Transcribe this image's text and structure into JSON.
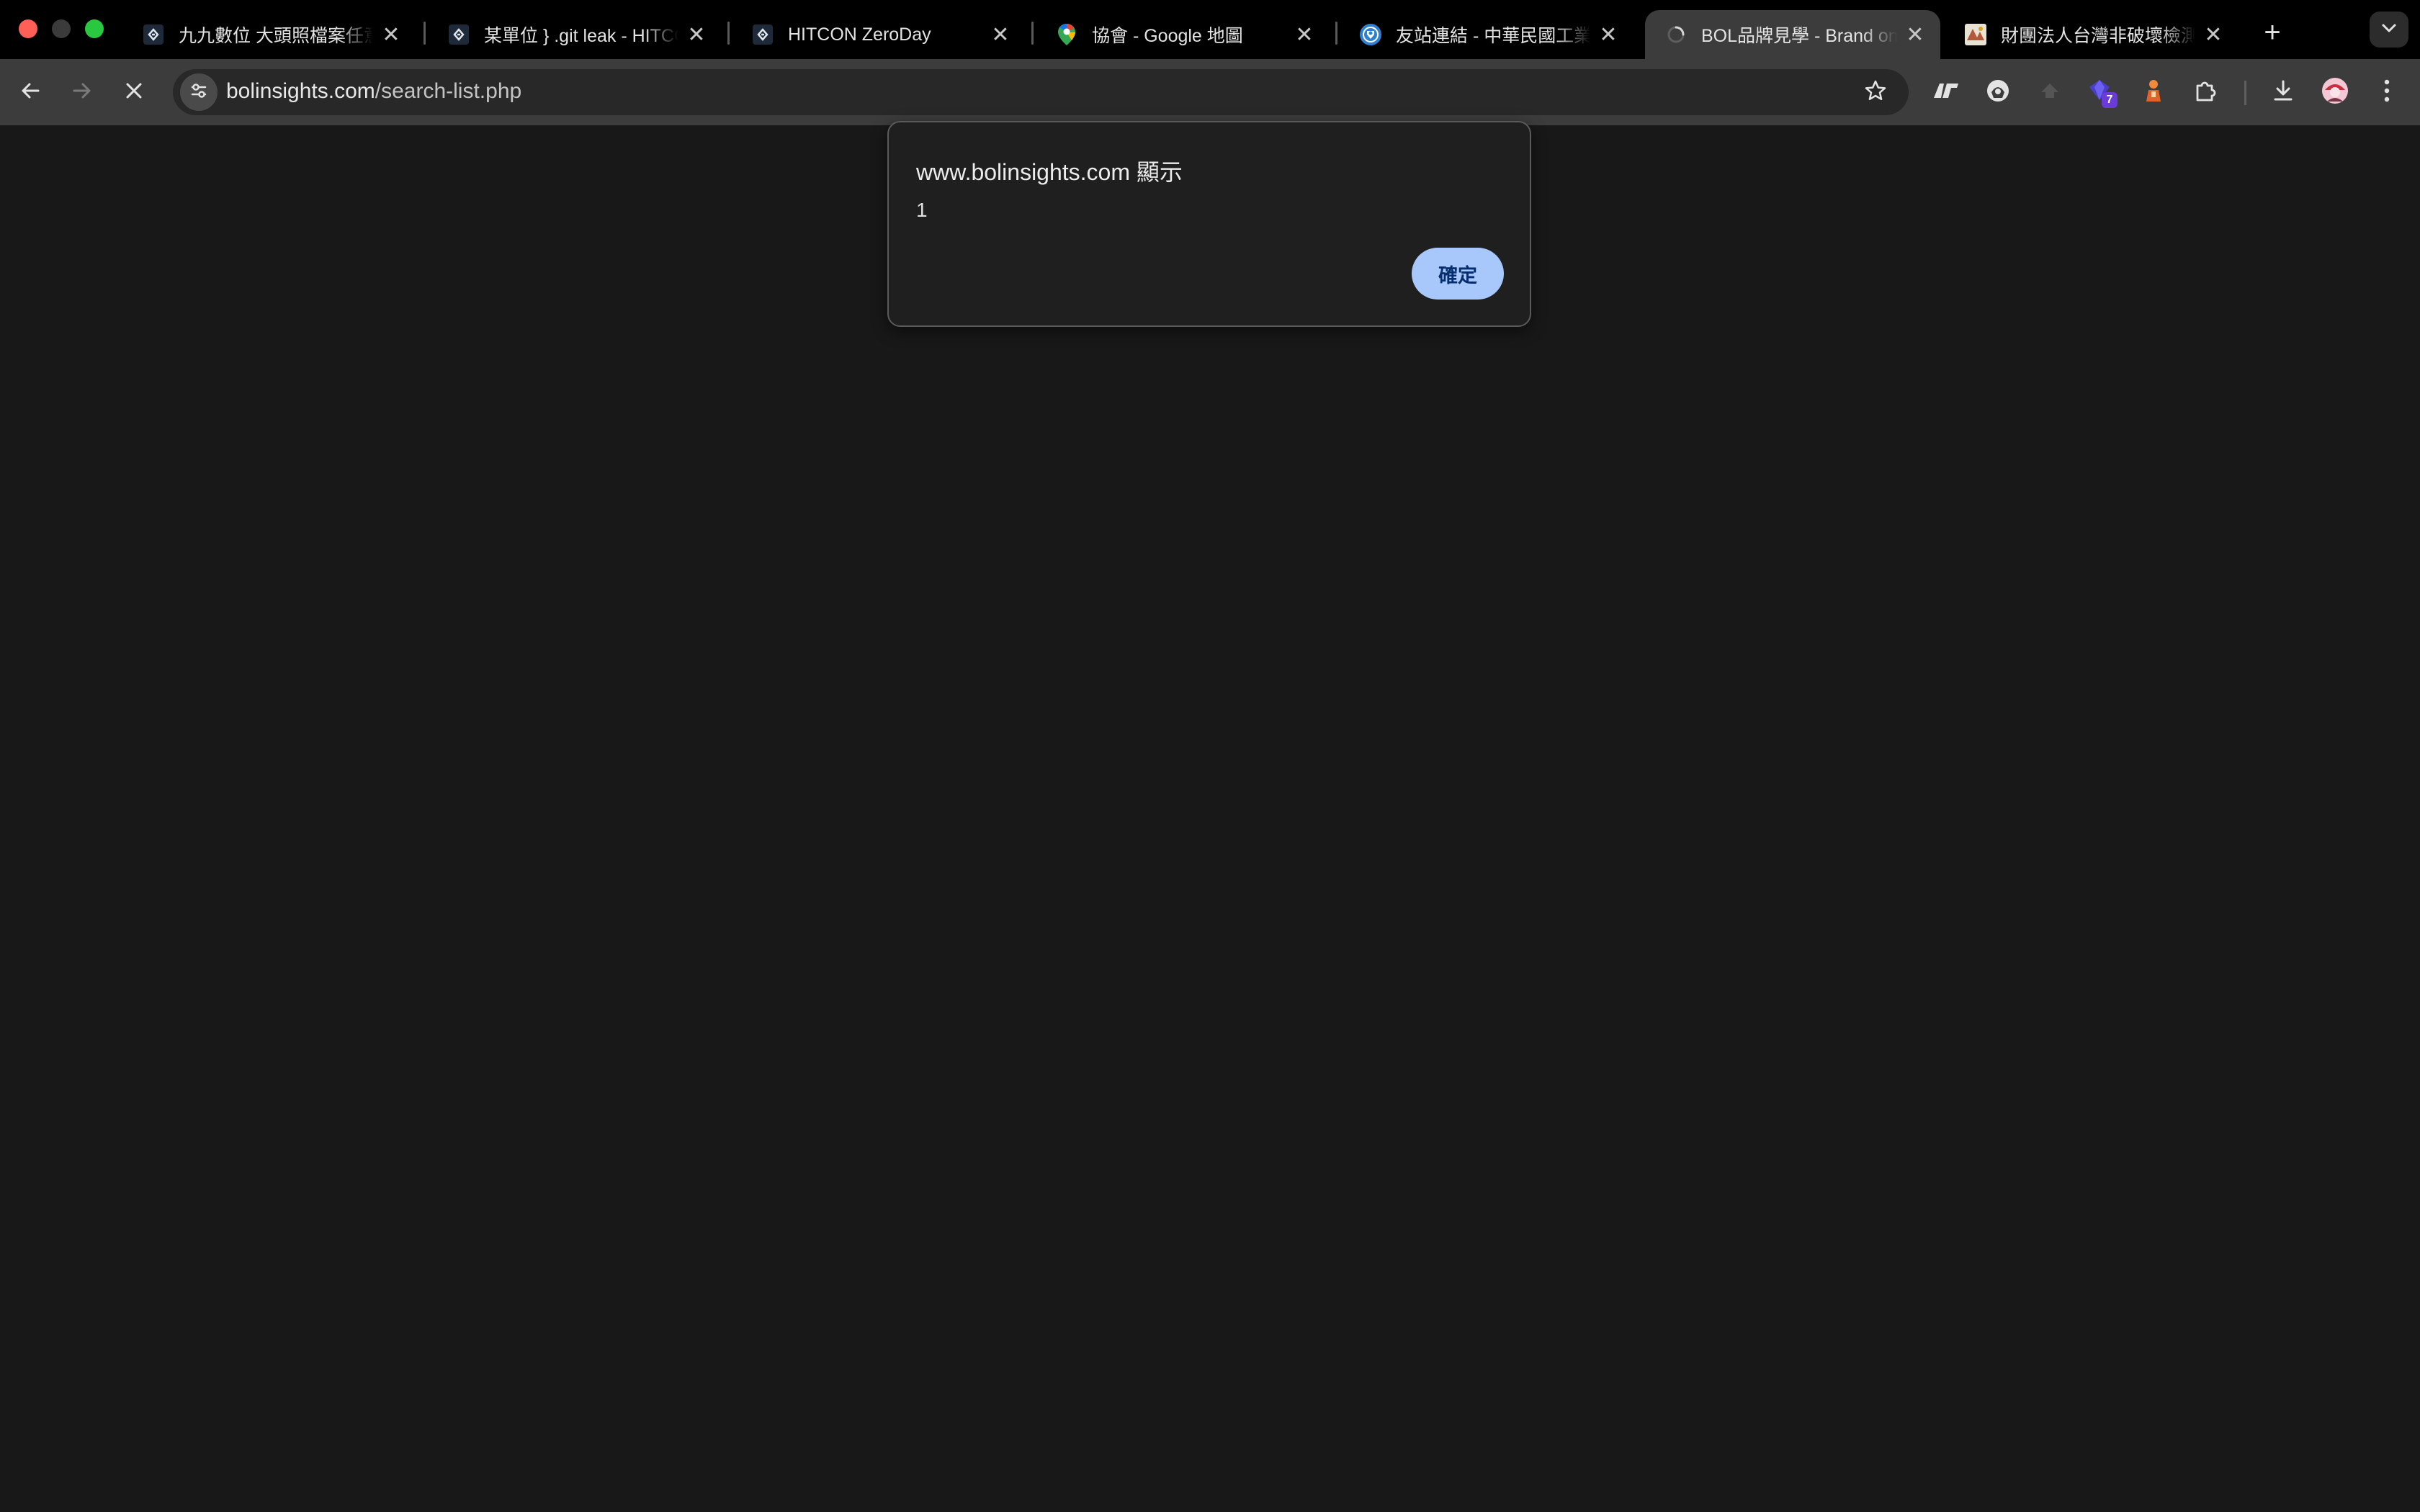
{
  "tabs": [
    {
      "title": "九九數位 大頭照檔案任意下載",
      "favicon": "hitcon-icon",
      "active": false
    },
    {
      "title": "某單位 } .git leak - HITCON ZeroDay",
      "favicon": "hitcon-icon",
      "active": false
    },
    {
      "title": "HITCON ZeroDay",
      "favicon": "hitcon-icon",
      "active": false
    },
    {
      "title": "協會 - Google 地圖",
      "favicon": "google-maps-icon",
      "active": false
    },
    {
      "title": "友站連結 - 中華民國工業安全衛生協會",
      "favicon": "globe-icon",
      "active": false
    },
    {
      "title": "BOL品牌見學 - Brand online",
      "favicon": "loading-spinner-icon",
      "active": true
    },
    {
      "title": "財團法人台灣非破壞檢測協會",
      "favicon": "site-logo-icon",
      "active": false
    }
  ],
  "address_bar": {
    "host": "bolinsights.com",
    "path": "/search-list.php"
  },
  "extensions": {
    "badge_count": "7"
  },
  "dialog": {
    "title": "www.bolinsights.com 顯示",
    "message": "1",
    "ok_label": "確定"
  },
  "colors": {
    "tab_strip_bg": "#000000",
    "toolbar_bg": "#3c3c3c",
    "page_bg": "#181818",
    "dialog_bg": "#1f1f1f",
    "ok_button_bg": "#a8c7fa",
    "badge_bg": "#6a3bd8"
  }
}
